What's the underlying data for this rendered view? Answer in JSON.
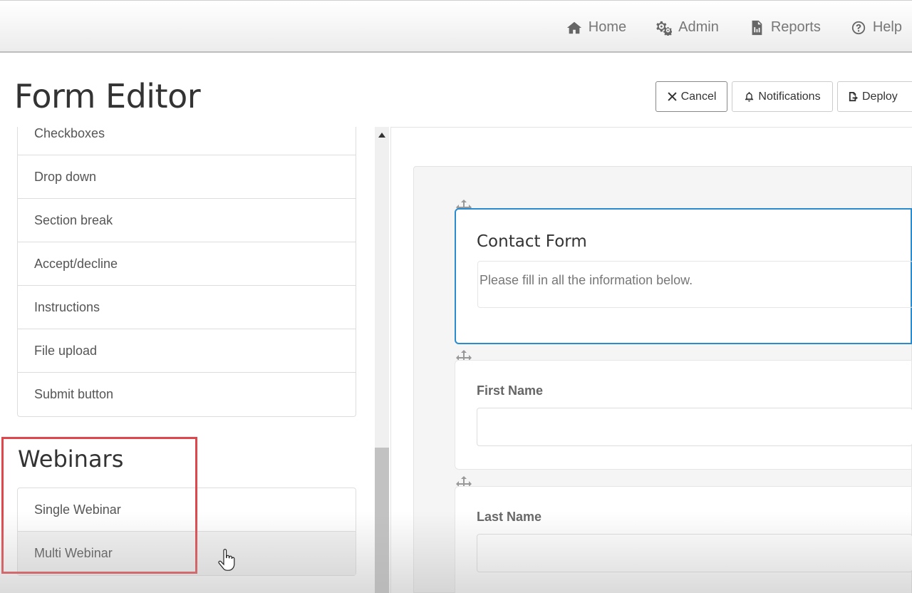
{
  "nav": {
    "items": [
      {
        "label": "Home",
        "icon": "home-icon"
      },
      {
        "label": "Admin",
        "icon": "gears-icon"
      },
      {
        "label": "Reports",
        "icon": "report-file-icon"
      },
      {
        "label": "Help",
        "icon": "help-circle-icon"
      }
    ]
  },
  "page": {
    "title": "Form Editor"
  },
  "actions": {
    "cancel_label": "Cancel",
    "notifications_label": "Notifications",
    "deploy_label": "Deploy"
  },
  "sidebar": {
    "fields": [
      "Checkboxes",
      "Drop down",
      "Section break",
      "Accept/decline",
      "Instructions",
      "File upload",
      "Submit button"
    ],
    "webinars_heading": "Webinars",
    "webinars": [
      "Single Webinar",
      "Multi Webinar"
    ]
  },
  "form": {
    "title": "Contact Form",
    "description": "Please fill in all the information below.",
    "fields": [
      {
        "label": "First Name"
      },
      {
        "label": "Last Name"
      }
    ]
  },
  "colors": {
    "highlight": "#e0474c",
    "selected_border": "#2a8ccf"
  }
}
